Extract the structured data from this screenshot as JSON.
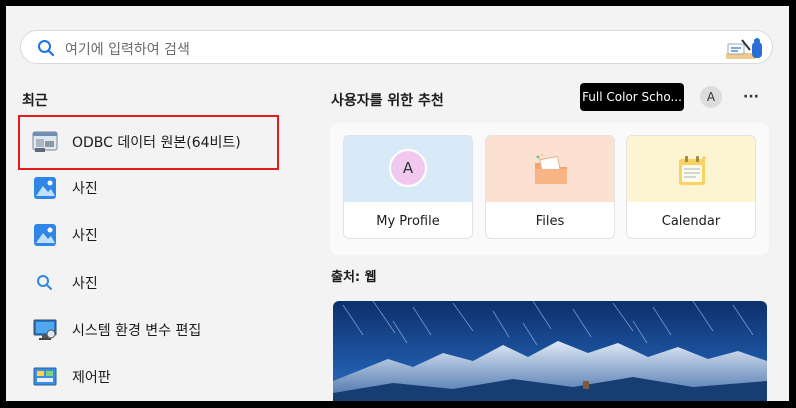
{
  "search": {
    "placeholder": "여기에 입력하여 검색"
  },
  "recent": {
    "title": "최근",
    "items": [
      {
        "label": "ODBC 데이터 원본(64비트)",
        "icon": "odbc-icon"
      },
      {
        "label": "사진",
        "icon": "photos-icon"
      },
      {
        "label": "사진",
        "icon": "photos-icon"
      },
      {
        "label": "사진",
        "icon": "search-photos-icon"
      },
      {
        "label": "시스템 환경 변수 편집",
        "icon": "system-settings-icon"
      },
      {
        "label": "제어판",
        "icon": "control-panel-icon"
      }
    ]
  },
  "recommended": {
    "title": "사용자를 위한 추천",
    "school_button": "Full Color Scho...",
    "avatar_letter": "A",
    "more": "···",
    "tiles": [
      {
        "label": "My Profile",
        "avatar_letter": "A",
        "icon": "profile-icon"
      },
      {
        "label": "Files",
        "icon": "folder-icon"
      },
      {
        "label": "Calendar",
        "icon": "calendar-icon"
      }
    ]
  },
  "web": {
    "source_label": "출처: 웹"
  },
  "colors": {
    "highlight_border": "#e21b1b",
    "accent_blue": "#1a73e8"
  }
}
